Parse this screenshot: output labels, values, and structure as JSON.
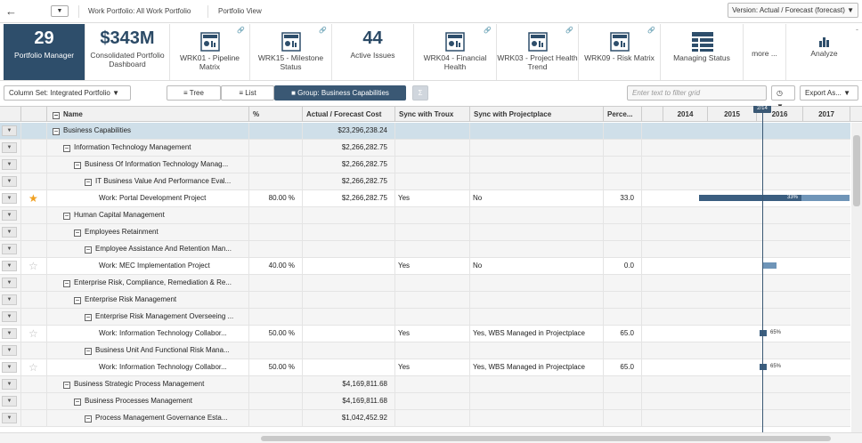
{
  "topbar": {
    "back_icon": "back-arrow-icon",
    "work_portfolio": "Work Portfolio: All Work Portfolio",
    "portfolio_view": "Portfolio View",
    "version": "Version: Actual / Forecast (forecast)"
  },
  "tiles": [
    {
      "big": "29",
      "label": "Portfolio Manager",
      "active": true
    },
    {
      "big": "$343M",
      "label": "Consolidated Portfolio Dashboard"
    },
    {
      "icon": "report-icon",
      "label": "WRK01 - Pipeline Matrix"
    },
    {
      "icon": "report-icon",
      "label": "WRK15 - Milestone Status"
    },
    {
      "big": "44",
      "label": "Active Issues"
    },
    {
      "icon": "report-icon",
      "label": "WRK04 - Financial Health"
    },
    {
      "icon": "report-icon",
      "label": "WRK03 - Project Health Trend"
    },
    {
      "icon": "report-icon",
      "label": "WRK09 - Risk Matrix"
    },
    {
      "icon": "grid-icon",
      "label": "Managing Status"
    },
    {
      "label": "more ..."
    },
    {
      "icon": "bar-chart-icon",
      "label": "Analyze"
    }
  ],
  "toolbar": {
    "column_set": "Column Set: Integrated Portfolio",
    "tree": "Tree",
    "list": "List",
    "group": "Group: Business Capabilities",
    "sigma": "Σ",
    "filter_placeholder": "Enter text to filter grid",
    "export": "Export As..."
  },
  "columns": [
    "Name",
    "%",
    "Actual / Forecast Cost",
    "Sync with Troux",
    "Sync with Projectplace",
    "Perce..."
  ],
  "timeline": {
    "years": [
      "2014",
      "2015",
      "2016",
      "2017"
    ],
    "today": "2/14"
  },
  "rows": [
    {
      "indent": 0,
      "toggle": true,
      "name": "Business Capabilities",
      "pct": "",
      "cost": "$23,296,238.24",
      "troux": "",
      "pp": "",
      "perc": "",
      "sel": true
    },
    {
      "indent": 1,
      "toggle": true,
      "name": "Information Technology Management",
      "pct": "",
      "cost": "$2,266,282.75",
      "troux": "",
      "pp": "",
      "perc": "",
      "grp": true
    },
    {
      "indent": 2,
      "toggle": true,
      "name": "Business Of Information Technology Manag...",
      "pct": "",
      "cost": "$2,266,282.75",
      "troux": "",
      "pp": "",
      "perc": "",
      "grp": true
    },
    {
      "indent": 3,
      "toggle": true,
      "name": "IT Business Value And Performance Eval...",
      "pct": "",
      "cost": "$2,266,282.75",
      "troux": "",
      "pp": "",
      "perc": "",
      "grp": true
    },
    {
      "indent": 4,
      "toggle": false,
      "star": "filled",
      "name": "Work: Portal Development Project",
      "pct": "80.00 %",
      "cost": "$2,266,282.75",
      "troux": "Yes",
      "pp": "No",
      "perc": "33.0",
      "gantt_label": "33%"
    },
    {
      "indent": 1,
      "toggle": true,
      "name": "Human Capital Management",
      "pct": "",
      "cost": "",
      "troux": "",
      "pp": "",
      "perc": "",
      "grp": true
    },
    {
      "indent": 2,
      "toggle": true,
      "name": "Employees Retainment",
      "pct": "",
      "cost": "",
      "troux": "",
      "pp": "",
      "perc": "",
      "grp": true
    },
    {
      "indent": 3,
      "toggle": true,
      "name": "Employee Assistance And Retention Man...",
      "pct": "",
      "cost": "",
      "troux": "",
      "pp": "",
      "perc": "",
      "grp": true
    },
    {
      "indent": 4,
      "toggle": false,
      "star": "empty",
      "name": "Work: MEC Implementation Project",
      "pct": "40.00 %",
      "cost": "",
      "troux": "Yes",
      "pp": "No",
      "perc": "0.0"
    },
    {
      "indent": 1,
      "toggle": true,
      "name": "Enterprise Risk, Compliance, Remediation & Re...",
      "pct": "",
      "cost": "",
      "troux": "",
      "pp": "",
      "perc": "",
      "grp": true
    },
    {
      "indent": 2,
      "toggle": true,
      "name": "Enterprise Risk Management",
      "pct": "",
      "cost": "",
      "troux": "",
      "pp": "",
      "perc": "",
      "grp": true
    },
    {
      "indent": 3,
      "toggle": true,
      "name": "Enterprise Risk Management Overseeing ...",
      "pct": "",
      "cost": "",
      "troux": "",
      "pp": "",
      "perc": "",
      "grp": true
    },
    {
      "indent": 4,
      "toggle": false,
      "star": "empty",
      "name": "Work: Information Technology Collabor...",
      "pct": "50.00 %",
      "cost": "",
      "troux": "Yes",
      "pp": "Yes, WBS Managed in Projectplace",
      "perc": "65.0",
      "gantt_label": "65%"
    },
    {
      "indent": 3,
      "toggle": true,
      "name": "Business Unit And Functional Risk Mana...",
      "pct": "",
      "cost": "",
      "troux": "",
      "pp": "",
      "perc": "",
      "grp": true
    },
    {
      "indent": 4,
      "toggle": false,
      "star": "empty",
      "name": "Work: Information Technology Collabor...",
      "pct": "50.00 %",
      "cost": "",
      "troux": "Yes",
      "pp": "Yes, WBS Managed in Projectplace",
      "perc": "65.0",
      "gantt_label": "65%"
    },
    {
      "indent": 1,
      "toggle": true,
      "name": "Business Strategic Process Management",
      "pct": "",
      "cost": "$4,169,811.68",
      "troux": "",
      "pp": "",
      "perc": "",
      "grp": true
    },
    {
      "indent": 2,
      "toggle": true,
      "name": "Business Processes Management",
      "pct": "",
      "cost": "$4,169,811.68",
      "troux": "",
      "pp": "",
      "perc": "",
      "grp": true
    },
    {
      "indent": 3,
      "toggle": true,
      "name": "Process Management Governance Esta...",
      "pct": "",
      "cost": "$1,042,452.92",
      "troux": "",
      "pp": "",
      "perc": "",
      "grp": true
    }
  ],
  "colors": {
    "accent": "#2e4e6b",
    "bar": "#3b5e80",
    "star": "#f0a020"
  }
}
